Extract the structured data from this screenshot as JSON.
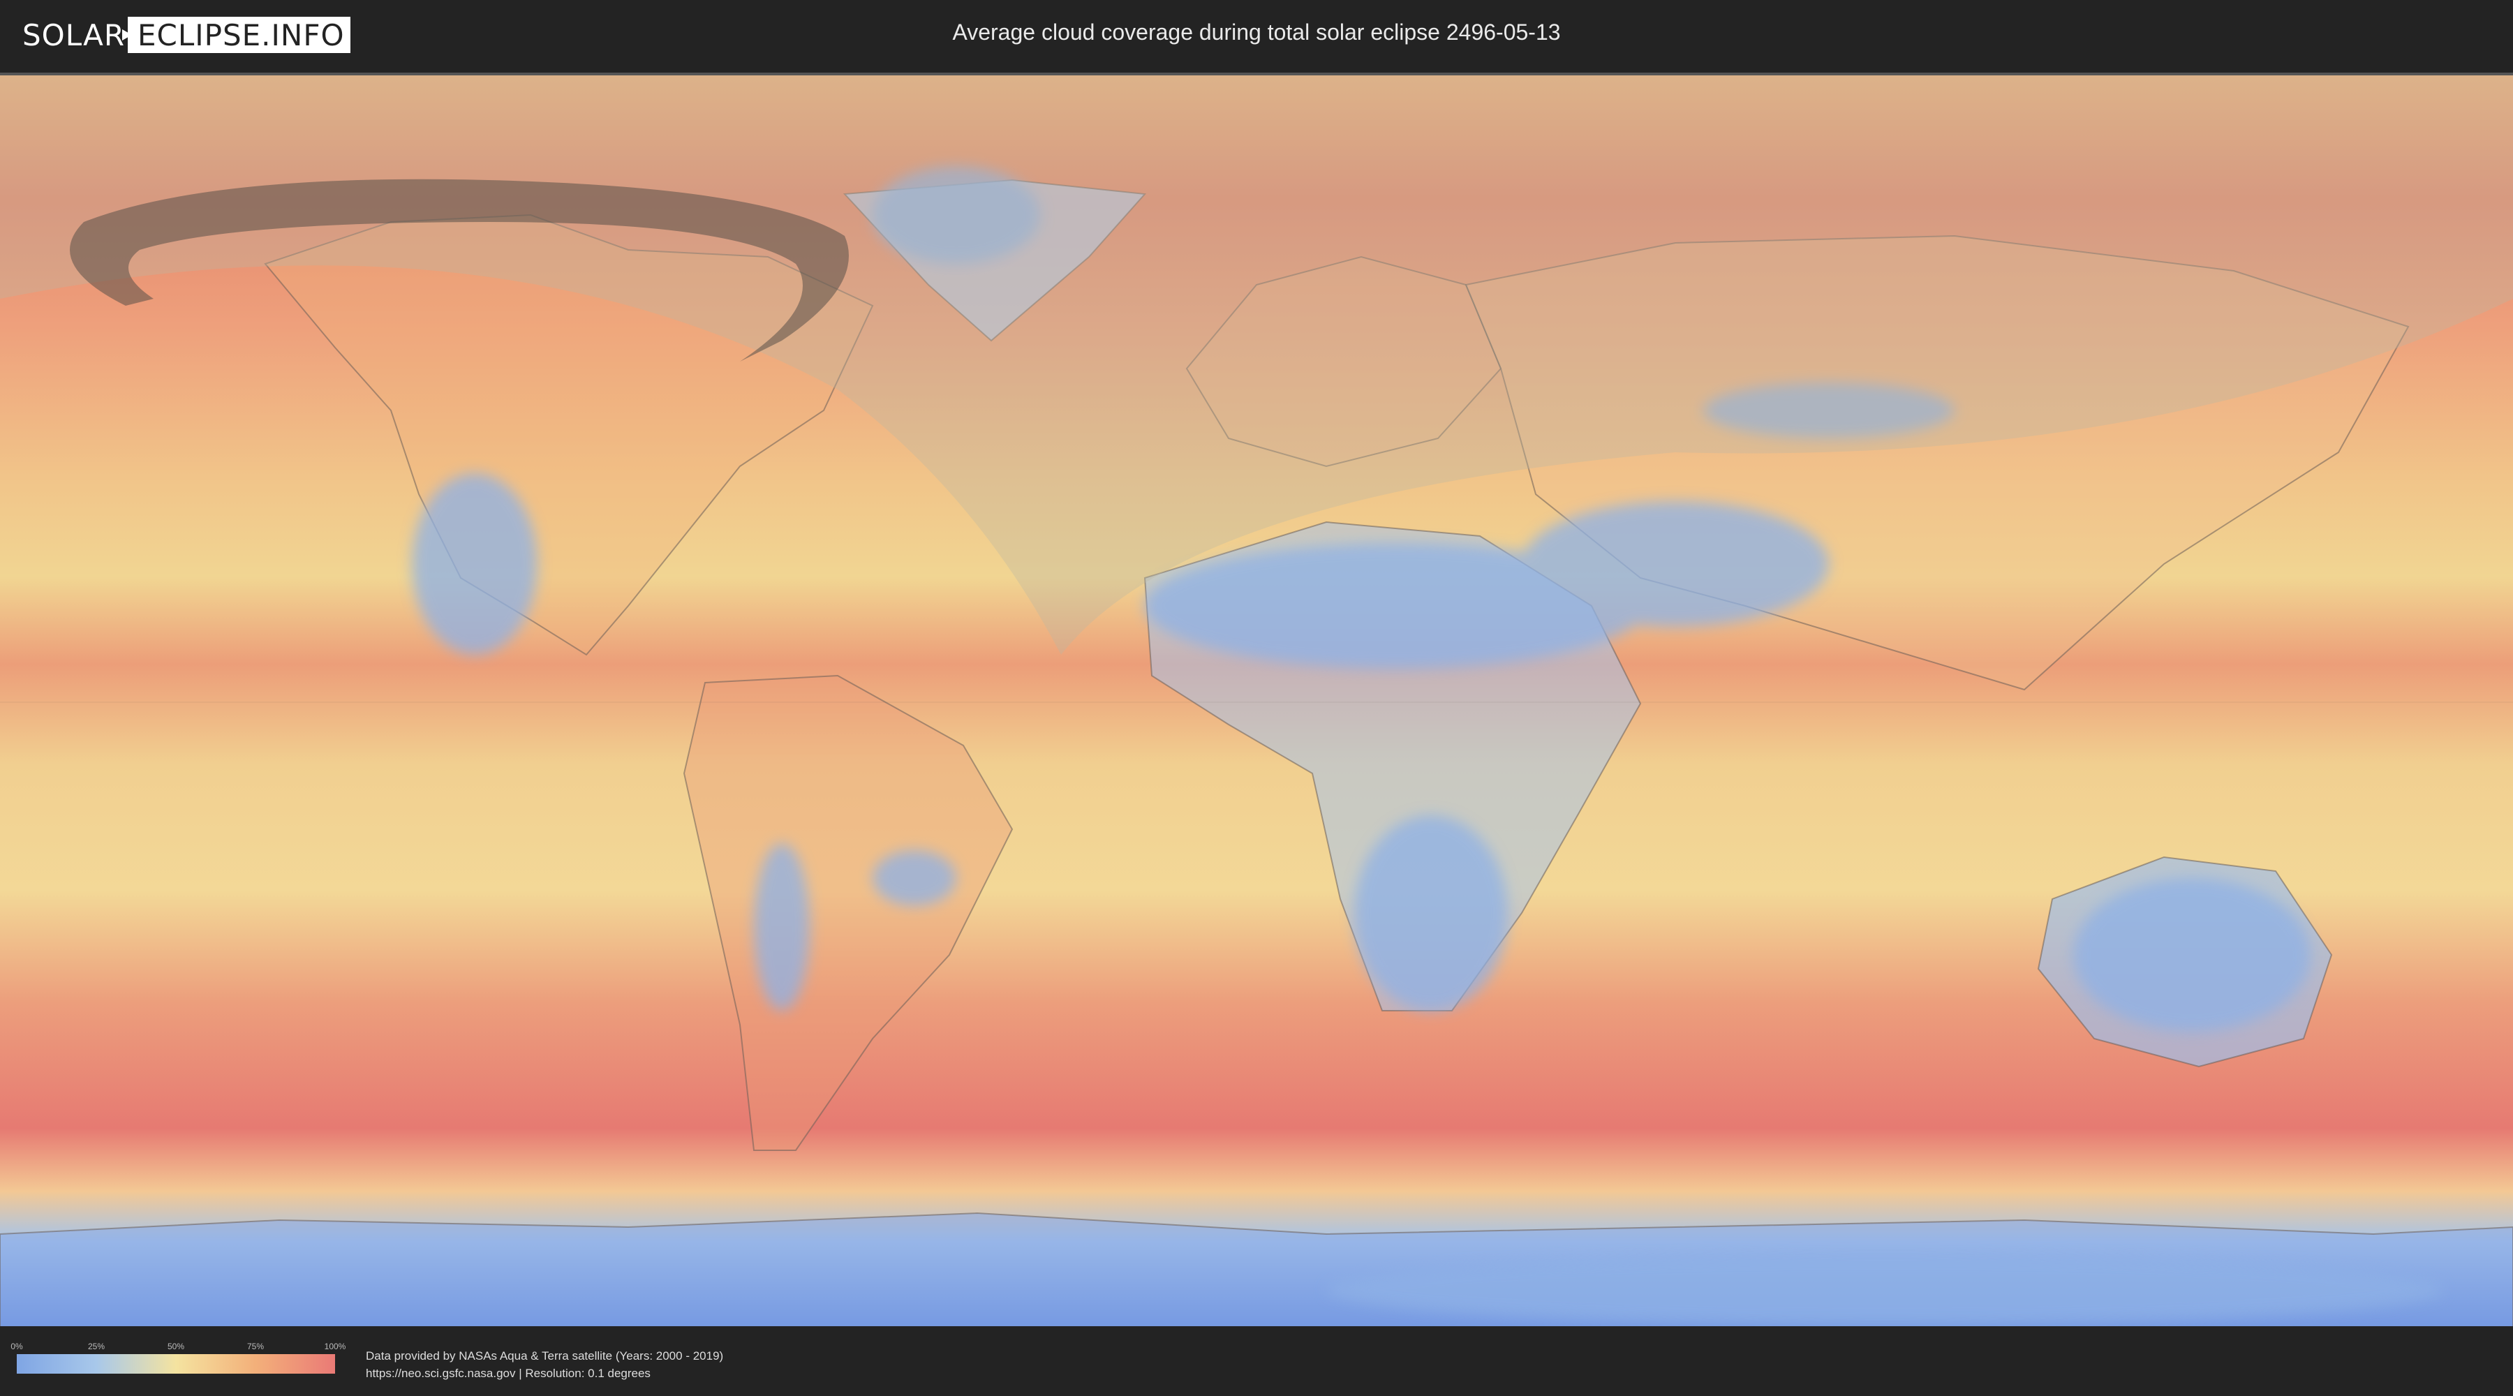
{
  "header": {
    "logo_left": "SOLAR",
    "logo_right": "ECLIPSE.INFO",
    "title": "Average cloud coverage during total solar eclipse 2496-05-13"
  },
  "legend": {
    "ticks": [
      "0%",
      "25%",
      "50%",
      "75%",
      "100%"
    ],
    "colors": [
      "#7fa5e4",
      "#a8c8ea",
      "#f4e3a0",
      "#f3b07a",
      "#ea7a76"
    ]
  },
  "credits": {
    "line1": "Data provided by NASAs Aqua & Terra satellite (Years: 2000 - 2019)",
    "line2": "https://neo.sci.gsfc.nasa.gov | Resolution: 0.1 degrees"
  },
  "map": {
    "icons": [
      "world-map",
      "eclipse-path",
      "visibility-zone"
    ]
  }
}
